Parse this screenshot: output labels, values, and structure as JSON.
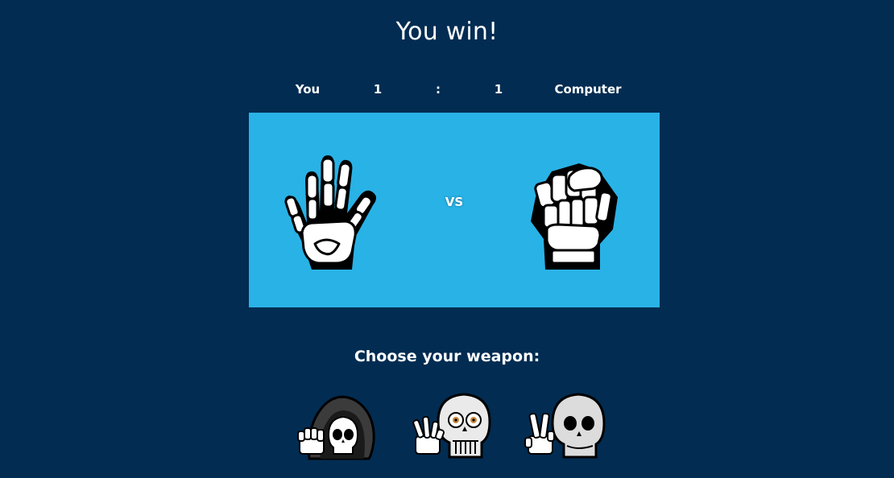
{
  "header": {
    "title": "You win!"
  },
  "scoreboard": {
    "player_label": "You",
    "player_score": "1",
    "separator": ":",
    "computer_score": "1",
    "computer_label": "Computer"
  },
  "arena": {
    "background": "#29b2e6",
    "player_choice_icon": "open-skeleton-hand-icon",
    "vs_label": "VS",
    "computer_choice_icon": "skeleton-fist-icon"
  },
  "choices": {
    "prompt": "Choose your weapon:",
    "options": [
      {
        "icon": "hooded-reaper-skull-icon"
      },
      {
        "icon": "skull-with-eyes-icon"
      },
      {
        "icon": "skull-peace-sign-icon"
      }
    ]
  },
  "colors": {
    "page_background": "#022c52",
    "text": "#ffffff"
  }
}
